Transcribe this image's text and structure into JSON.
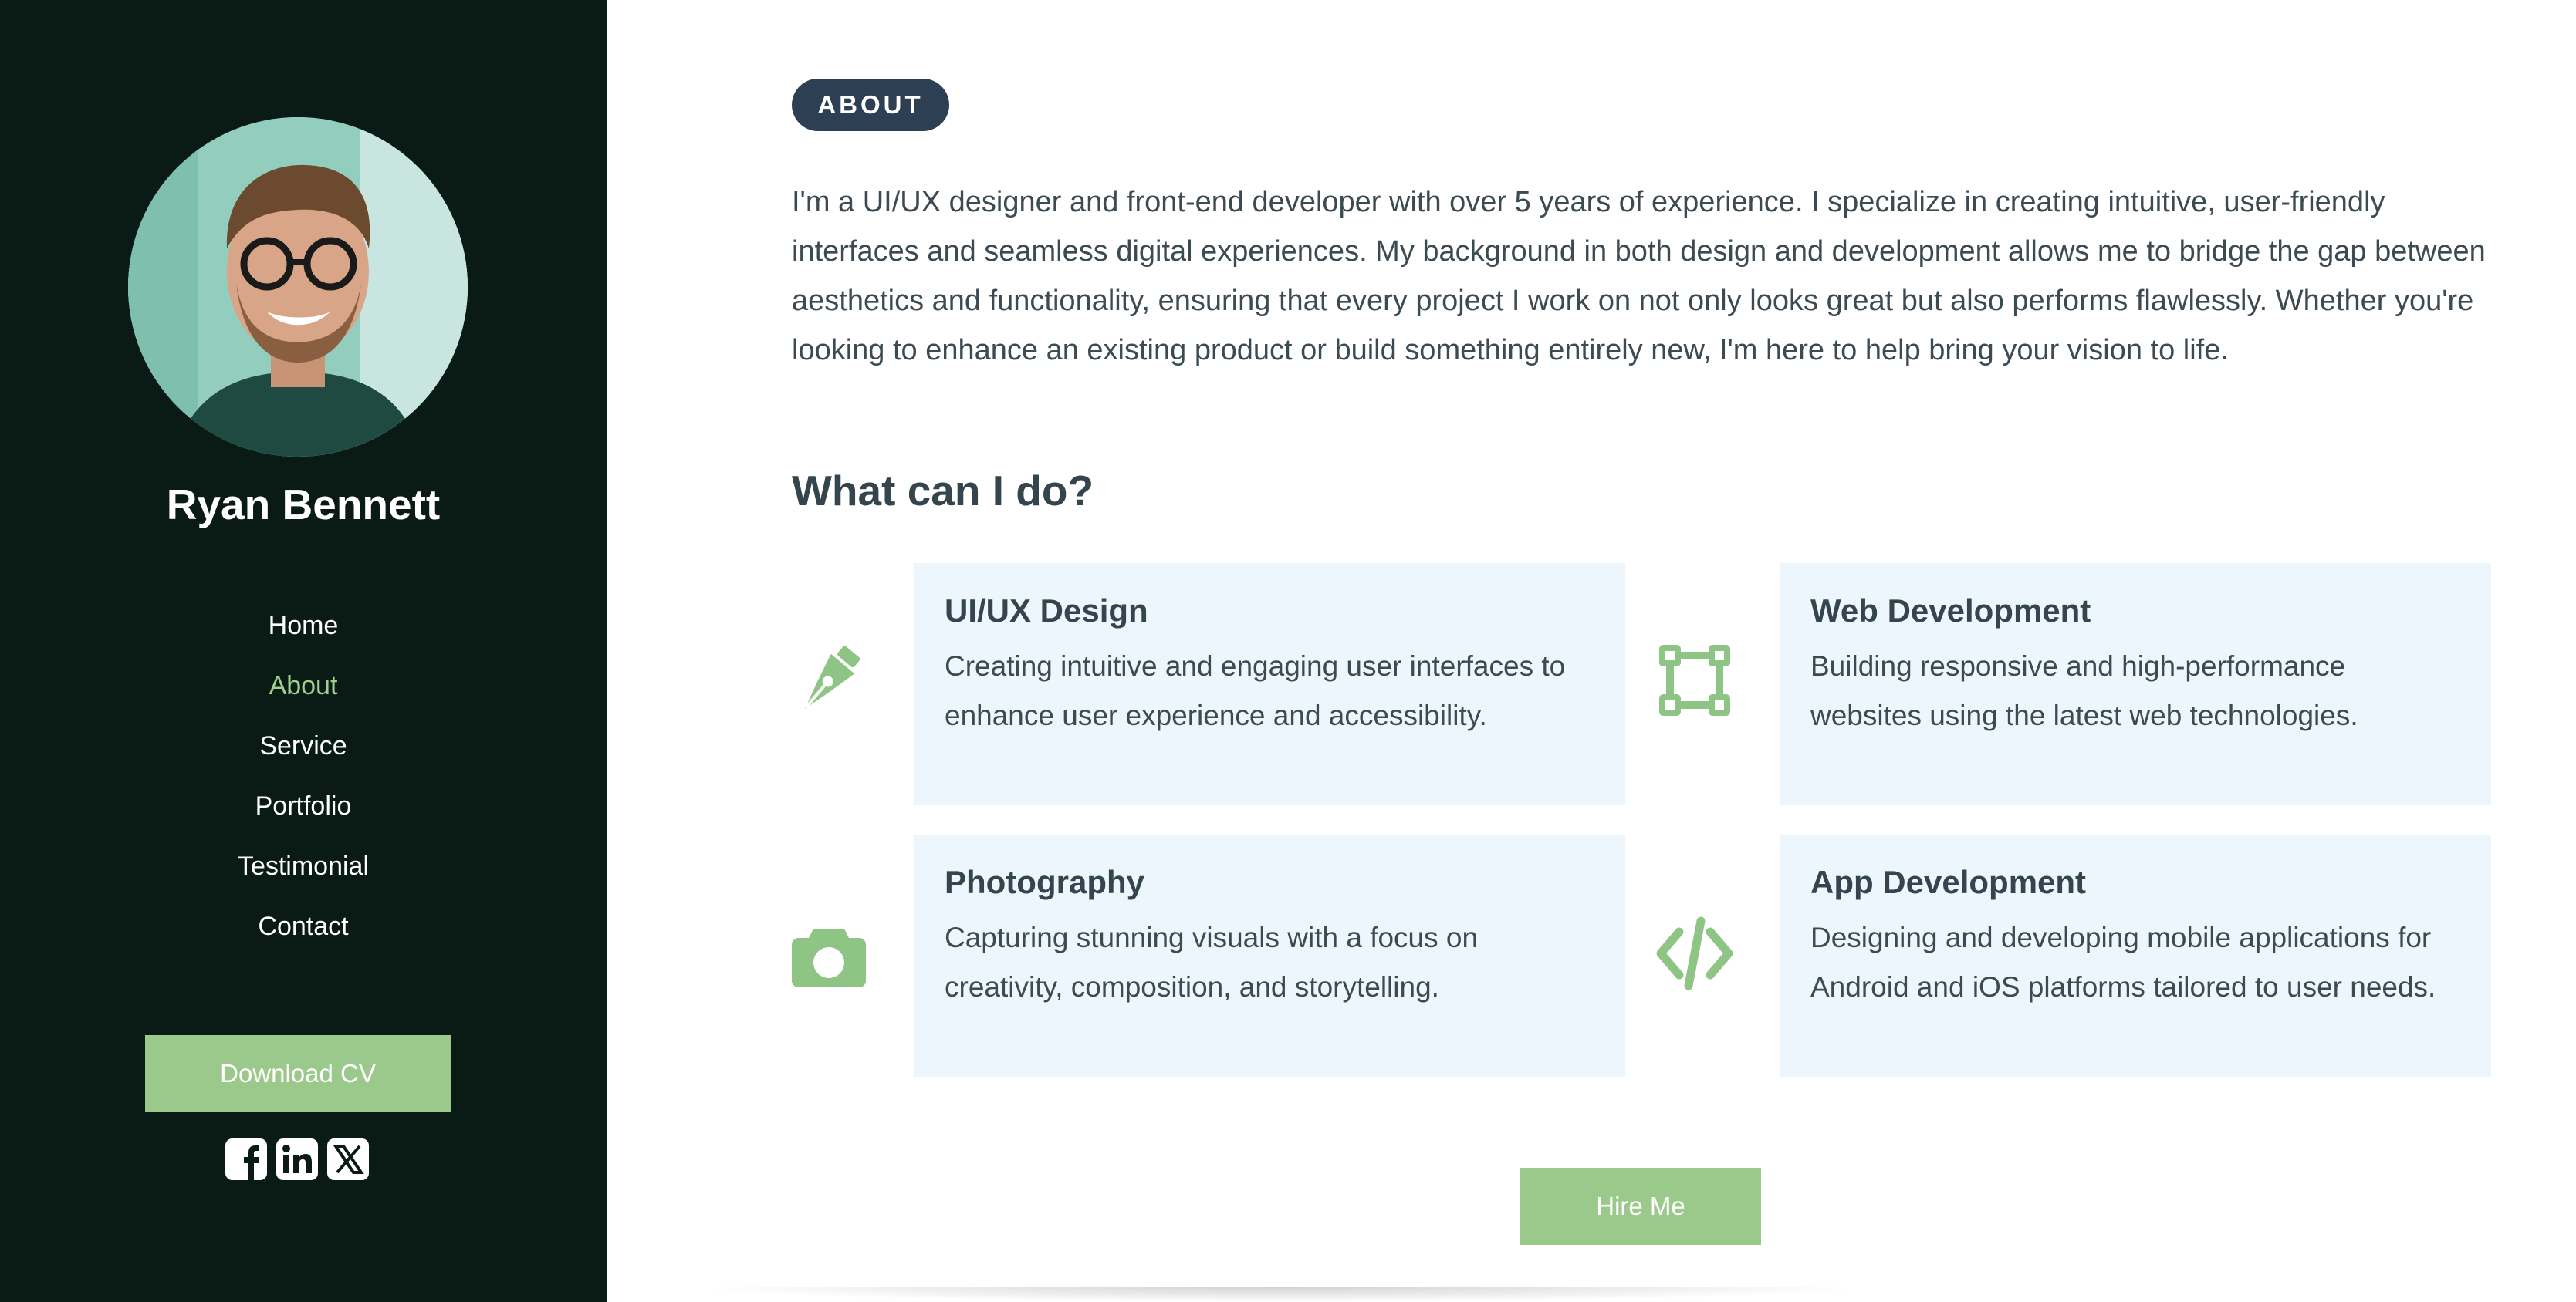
{
  "sidebar": {
    "name": "Ryan Bennett",
    "nav": [
      {
        "label": "Home"
      },
      {
        "label": "About"
      },
      {
        "label": "Service"
      },
      {
        "label": "Portfolio"
      },
      {
        "label": "Testimonial"
      },
      {
        "label": "Contact"
      }
    ],
    "active_nav": "About",
    "download_label": "Download CV",
    "socials": [
      "facebook-icon",
      "linkedin-icon",
      "x-icon"
    ]
  },
  "about": {
    "badge": "ABOUT",
    "text": "I'm a UI/UX designer and front-end developer with over 5 years of experience. I specialize in creating intuitive, user-friendly interfaces and seamless digital experiences. My background in both design and development allows me to bridge the gap between aesthetics and functionality, ensuring that every project I work on not only looks great but also performs flawlessly. Whether you're looking to enhance an existing product or build something entirely new, I'm here to help bring your vision to life."
  },
  "services": {
    "title": "What can I do?",
    "items": [
      {
        "icon": "pen-tool-icon",
        "title": "UI/UX Design",
        "desc": "Creating intuitive and engaging user interfaces to enhance user experience and accessibility."
      },
      {
        "icon": "vector-nodes-icon",
        "title": "Web Development",
        "desc": "Building responsive and high-performance websites using the latest web technologies."
      },
      {
        "icon": "camera-icon",
        "title": "Photography",
        "desc": "Capturing stunning visuals with a focus on creativity, composition, and storytelling."
      },
      {
        "icon": "code-icon",
        "title": "App Development",
        "desc": "Designing and developing mobile applications for Android and iOS platforms tailored to user needs."
      }
    ]
  },
  "hire_label": "Hire Me",
  "colors": {
    "sidebar_bg": "#0a1a15",
    "accent_green": "#9ac98b",
    "active_nav": "#9fd08e",
    "badge_bg": "#2d3f52",
    "card_bg": "#eef6fd",
    "text": "#3c4a52"
  }
}
